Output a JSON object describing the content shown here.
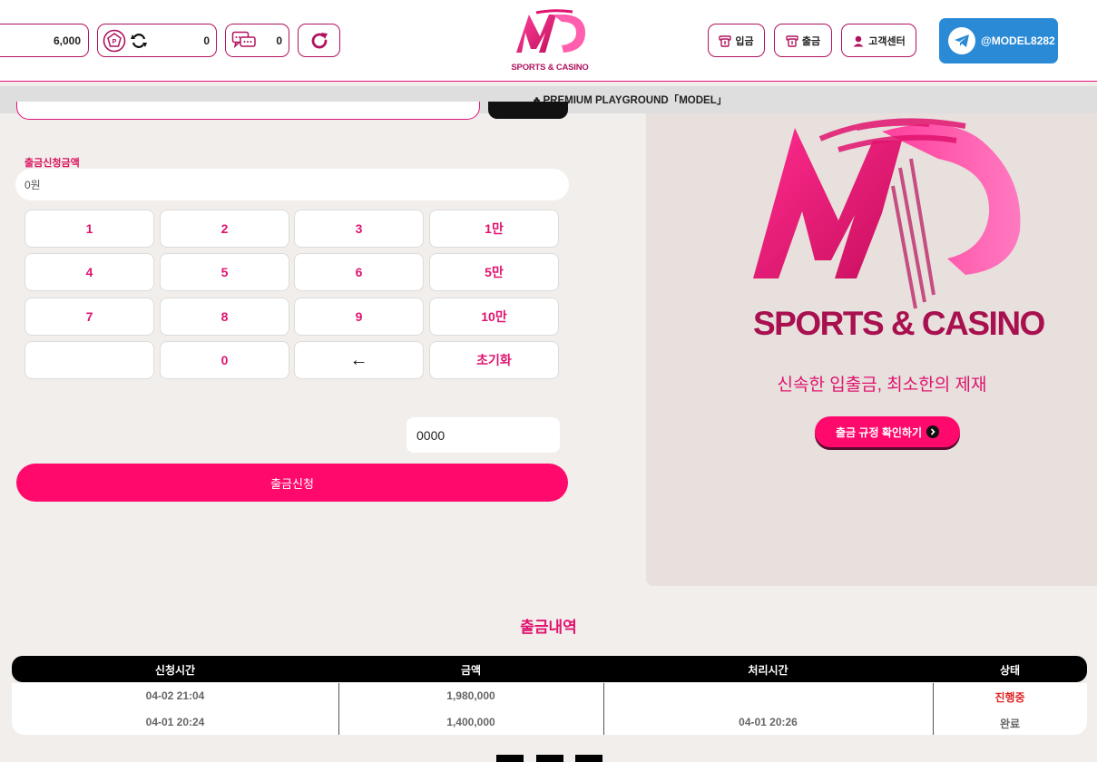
{
  "header": {
    "balance": "6,000",
    "point": "0",
    "messages": "0",
    "logo_tag": "SPORTS & CASINO",
    "nav": [
      {
        "label": "입금",
        "icon": "deposit-icon"
      },
      {
        "label": "출금",
        "icon": "withdraw-icon"
      },
      {
        "label": "고객센터",
        "icon": "support-icon"
      }
    ],
    "telegram": "@MODEL8282"
  },
  "ticker": "♣ PREMIUM PLAYGROUND「MODEL」",
  "form": {
    "amount_label": "출금신청금액",
    "amount_value": "0원",
    "keys": [
      "1",
      "2",
      "3",
      "1만",
      "4",
      "5",
      "6",
      "5만",
      "7",
      "8",
      "9",
      "10만",
      "",
      "0",
      "←",
      "초기화"
    ],
    "pin_value": "0000",
    "submit_label": "출금신청"
  },
  "promo": {
    "brand": "SPORTS & CASINO",
    "slogan": "신속한 입출금, 최소한의 제재",
    "rule_button": "출금 규정 확인하기"
  },
  "history": {
    "title": "출금내역",
    "columns": [
      "신청시간",
      "금액",
      "처리시간",
      "상태"
    ],
    "rows": [
      {
        "requested": "04-02 21:04",
        "amount": "1,980,000",
        "processed": "",
        "status": "진행중"
      },
      {
        "requested": "04-01 20:24",
        "amount": "1,400,000",
        "processed": "04-01 20:26",
        "status": "완료"
      }
    ]
  },
  "colors": {
    "accent": "#ff0a6c",
    "brand": "#b0125e",
    "pending": "#e02424",
    "telegram": "#2a8ad6"
  }
}
